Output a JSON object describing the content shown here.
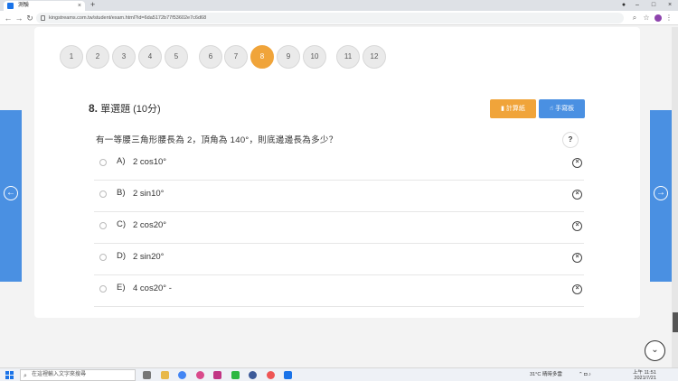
{
  "browser": {
    "tab_title": "測驗",
    "tab_close": "×",
    "new_tab": "+",
    "url": "kingstreams.com.tw/student/exam.html?id=6da5172b77f53602e7c6d68",
    "win_min": "–",
    "win_max": "□",
    "win_close": "×"
  },
  "question_nav": {
    "numbers": [
      "1",
      "2",
      "3",
      "4",
      "5",
      "6",
      "7",
      "8",
      "9",
      "10",
      "11",
      "12"
    ],
    "active": "8"
  },
  "question": {
    "number": "8.",
    "type_label": "單選題 (10分)",
    "text": "有一等腰三角形腰長為 2，頂角為 140°，則底邊邊長為多少？",
    "help": "?",
    "options": [
      {
        "letter": "A)",
        "text": "2 cos10°"
      },
      {
        "letter": "B)",
        "text": "2 sin10°"
      },
      {
        "letter": "C)",
        "text": "2 cos20°"
      },
      {
        "letter": "D)",
        "text": "2 sin20°"
      },
      {
        "letter": "E)",
        "text": "4 cos20° -"
      }
    ]
  },
  "buttons": {
    "orange": "計算紙",
    "blue": "手寫板"
  },
  "taskbar": {
    "search_placeholder": "在這裡輸入文字來搜尋",
    "weather": "31°C 晴時多雲",
    "time": "上午 11:51",
    "date": "2021/7/21"
  },
  "colors": {
    "accent_orange": "#f0a43a",
    "accent_blue": "#4a90e2"
  }
}
